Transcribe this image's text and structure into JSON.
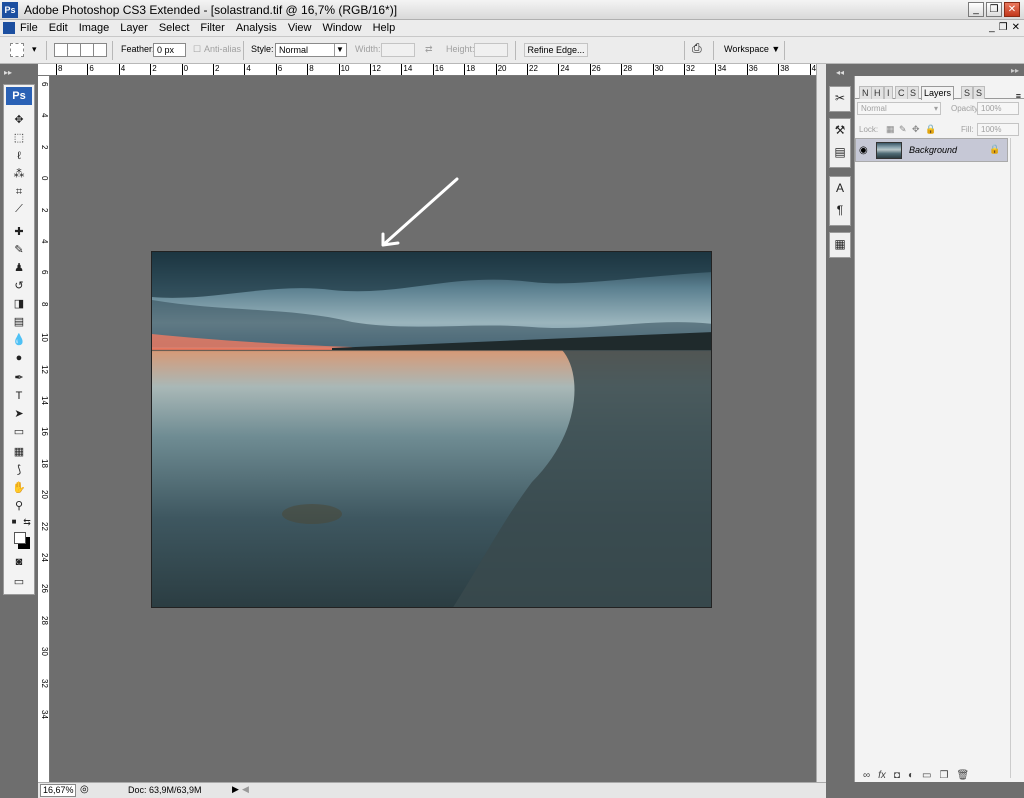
{
  "window": {
    "title": "Adobe Photoshop CS3 Extended - [solastrand.tif @ 16,7% (RGB/16*)]",
    "app_badge": "Ps",
    "minimize": "_",
    "maximize": "❐",
    "close": "✕"
  },
  "menu": {
    "items": [
      "File",
      "Edit",
      "Image",
      "Layer",
      "Select",
      "Filter",
      "Analysis",
      "View",
      "Window",
      "Help"
    ],
    "mdi_minimize": "_",
    "mdi_restore": "❐",
    "mdi_close": "✕"
  },
  "options": {
    "feather_label": "Feather:",
    "feather_value": "0 px",
    "antialias_label": "Anti-alias",
    "style_label": "Style:",
    "style_value": "Normal",
    "width_label": "Width:",
    "height_label": "Height:",
    "refine_edge_label": "Refine Edge...",
    "workspace_label": "Workspace"
  },
  "toolbox": {
    "badge": "Ps",
    "tools": [
      {
        "name": "move-tool",
        "glyph": "✥"
      },
      {
        "name": "marquee-tool",
        "glyph": "⬚"
      },
      {
        "name": "lasso-tool",
        "glyph": "ℓ"
      },
      {
        "name": "magic-wand-tool",
        "glyph": "⁂"
      },
      {
        "name": "crop-tool",
        "glyph": "⌗"
      },
      {
        "name": "slice-tool",
        "glyph": "⟋"
      },
      {
        "name": "healing-brush-tool",
        "glyph": "✚"
      },
      {
        "name": "brush-tool",
        "glyph": "✎"
      },
      {
        "name": "clone-stamp-tool",
        "glyph": "♟"
      },
      {
        "name": "history-brush-tool",
        "glyph": "↺"
      },
      {
        "name": "eraser-tool",
        "glyph": "◨"
      },
      {
        "name": "gradient-tool",
        "glyph": "▤"
      },
      {
        "name": "blur-tool",
        "glyph": "💧"
      },
      {
        "name": "dodge-tool",
        "glyph": "●"
      },
      {
        "name": "pen-tool",
        "glyph": "✒"
      },
      {
        "name": "type-tool",
        "glyph": "T"
      },
      {
        "name": "path-selection-tool",
        "glyph": "➤"
      },
      {
        "name": "shape-tool",
        "glyph": "▭"
      },
      {
        "name": "notes-tool",
        "glyph": "▦"
      },
      {
        "name": "eyedropper-tool",
        "glyph": "⟆"
      },
      {
        "name": "hand-tool",
        "glyph": "✋"
      },
      {
        "name": "zoom-tool",
        "glyph": "⚲"
      }
    ]
  },
  "ruler_top": [
    "8",
    "6",
    "4",
    "2",
    "0",
    "2",
    "4",
    "6",
    "8",
    "10",
    "12",
    "14",
    "16",
    "18",
    "20",
    "22",
    "24",
    "26",
    "28",
    "30",
    "32",
    "34",
    "36",
    "38",
    "40"
  ],
  "ruler_left": [
    "6",
    "4",
    "2",
    "0",
    "2",
    "4",
    "6",
    "8",
    "10",
    "12",
    "14",
    "16",
    "18",
    "20",
    "22",
    "24",
    "26",
    "28",
    "30",
    "32",
    "34"
  ],
  "status": {
    "zoom": "16,67%",
    "doc": "Doc: 63,9M/63,9M"
  },
  "layers_panel": {
    "tabs": [
      "N",
      "H",
      "I",
      "C",
      "S",
      "Layers",
      "S",
      "S"
    ],
    "active_tab": "Layers",
    "blend_mode": "Normal",
    "opacity_label": "Opacity:",
    "opacity_value": "100%",
    "lock_label": "Lock:",
    "fill_label": "Fill:",
    "fill_value": "100%",
    "layer_name": "Background",
    "footer_icons": [
      "link-icon",
      "fx-icon",
      "mask-icon",
      "adjustment-icon",
      "group-icon",
      "new-layer-icon",
      "trash-icon"
    ]
  },
  "colors": {
    "workspace_gray": "#6e6e6e",
    "ps_blue": "#2a61b5",
    "selected_layer": "#c6c8d6"
  }
}
